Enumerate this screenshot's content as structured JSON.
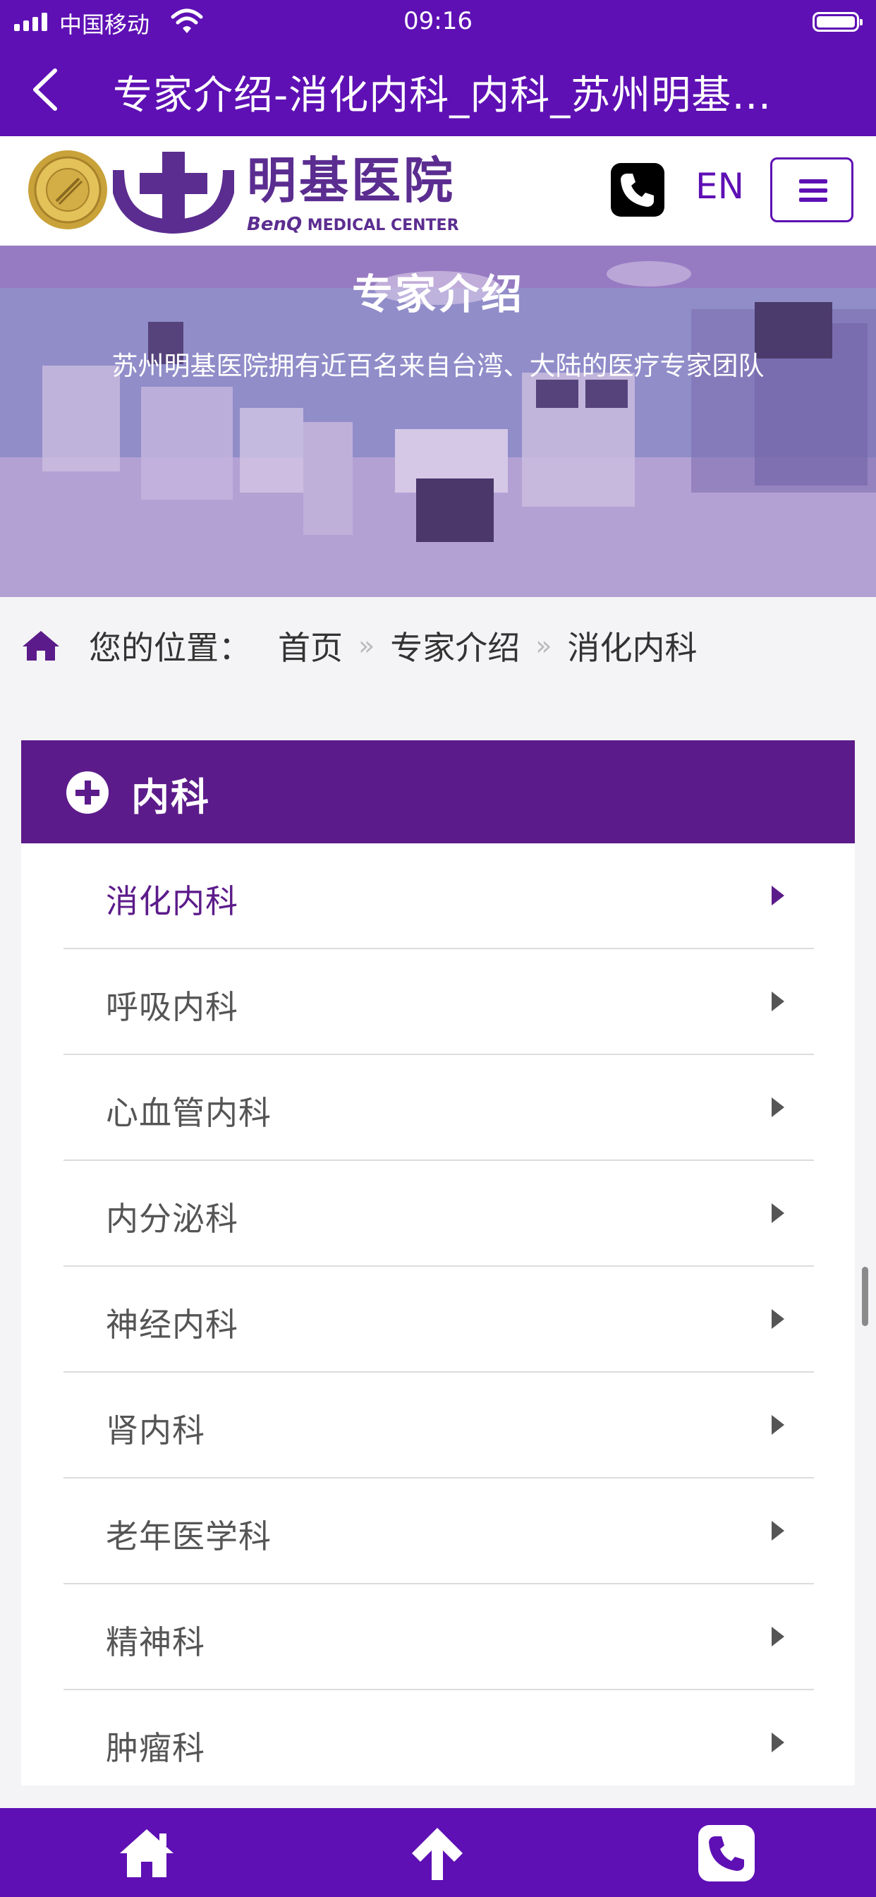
{
  "status_bar": {
    "carrier": "中国移动",
    "time": "09:16",
    "icons": [
      "signal-icon",
      "wifi-icon",
      "battery-icon"
    ]
  },
  "nav": {
    "back_icon": "chevron-left-icon",
    "title": "专家介绍-消化内科_内科_苏州明基医院"
  },
  "header": {
    "logo_cn": "明基医院",
    "logo_en_brand": "BenQ",
    "logo_en_text": "MEDICAL CENTER",
    "phone_icon": "phone-icon",
    "lang_link": "EN",
    "menu_icon": "hamburger-icon"
  },
  "banner": {
    "title": "专家介绍",
    "subtitle": "苏州明基医院拥有近百名来自台湾、大陆的医疗专家团队"
  },
  "breadcrumb": {
    "label": "您的位置：",
    "items": [
      "首页",
      "专家介绍",
      "消化内科"
    ],
    "separator": "»"
  },
  "category": {
    "title": "内科",
    "items": [
      {
        "label": "消化内科",
        "active": true
      },
      {
        "label": "呼吸内科",
        "active": false
      },
      {
        "label": "心血管内科",
        "active": false
      },
      {
        "label": "内分泌科",
        "active": false
      },
      {
        "label": "神经内科",
        "active": false
      },
      {
        "label": "肾内科",
        "active": false
      },
      {
        "label": "老年医学科",
        "active": false
      },
      {
        "label": "精神科",
        "active": false
      },
      {
        "label": "肿瘤科",
        "active": false
      }
    ]
  },
  "bottom_bar": {
    "icons": [
      "home-icon",
      "arrow-up-icon",
      "phone-icon"
    ]
  },
  "colors": {
    "brand_purple": "#5e10b4",
    "panel_purple": "#5c1b8a",
    "logo_purple": "#5b2d90"
  }
}
